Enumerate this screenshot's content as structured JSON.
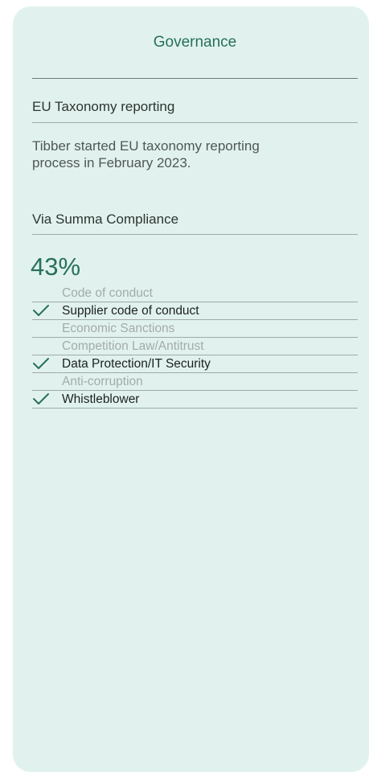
{
  "card": {
    "title": "Governance",
    "taxonomy": {
      "heading": "EU Taxonomy reporting",
      "text": "Tibber started EU taxonomy reporting\nprocess in February 2023."
    },
    "compliance": {
      "heading": "Via Summa Compliance",
      "percent": "43%",
      "items": [
        {
          "label": "Code of conduct",
          "done": false
        },
        {
          "label": "Supplier code of conduct",
          "done": true
        },
        {
          "label": "Economic Sanctions",
          "done": false
        },
        {
          "label": "Competition Law/Antitrust",
          "done": false
        },
        {
          "label": "Data Protection/IT Security",
          "done": true
        },
        {
          "label": "Anti-corruption",
          "done": false
        },
        {
          "label": "Whistleblower",
          "done": true
        }
      ]
    }
  },
  "colors": {
    "card_bg": "#e1f2ee",
    "accent": "#27705a",
    "check": "#27705a"
  }
}
